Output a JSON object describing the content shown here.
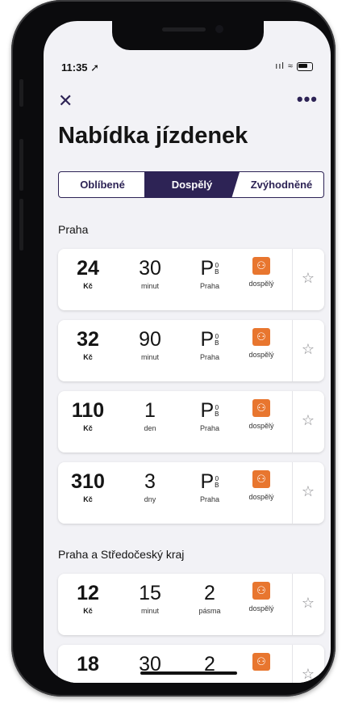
{
  "status_bar": {
    "time": "11:35 ➚",
    "icons": "ııl ≈"
  },
  "nav": {
    "close": "✕",
    "more": "•••"
  },
  "title": "Nabídka jízdenek",
  "tabs": [
    {
      "label": "Oblíbené"
    },
    {
      "label": "Dospělý"
    },
    {
      "label": "Zvýhodněné"
    }
  ],
  "sections": [
    {
      "title": "Praha",
      "tickets": [
        {
          "price": "24",
          "currency": "Kč",
          "duration": "30",
          "duration_unit": "minut",
          "zone": "P",
          "zone_sup": "0",
          "zone_sub": "B",
          "zone_label": "Praha",
          "type": "dospělý"
        },
        {
          "price": "32",
          "currency": "Kč",
          "duration": "90",
          "duration_unit": "minut",
          "zone": "P",
          "zone_sup": "0",
          "zone_sub": "B",
          "zone_label": "Praha",
          "type": "dospělý"
        },
        {
          "price": "110",
          "currency": "Kč",
          "duration": "1",
          "duration_unit": "den",
          "zone": "P",
          "zone_sup": "0",
          "zone_sub": "B",
          "zone_label": "Praha",
          "type": "dospělý"
        },
        {
          "price": "310",
          "currency": "Kč",
          "duration": "3",
          "duration_unit": "dny",
          "zone": "P",
          "zone_sup": "0",
          "zone_sub": "B",
          "zone_label": "Praha",
          "type": "dospělý"
        }
      ]
    },
    {
      "title": "Praha a Středočeský kraj",
      "tickets": [
        {
          "price": "12",
          "currency": "Kč",
          "duration": "15",
          "duration_unit": "minut",
          "zone": "2",
          "zone_label": "pásma",
          "type": "dospělý"
        },
        {
          "price": "18",
          "currency": "",
          "duration": "30",
          "duration_unit": "",
          "zone": "2",
          "zone_label": "",
          "type": ""
        }
      ]
    }
  ],
  "colors": {
    "accent": "#2d2355",
    "ticket_icon": "#e8762f",
    "screen_bg": "#f2f2f6"
  },
  "icons": {
    "ticket_type": "person-pair-icon",
    "favorite": "star-icon"
  }
}
